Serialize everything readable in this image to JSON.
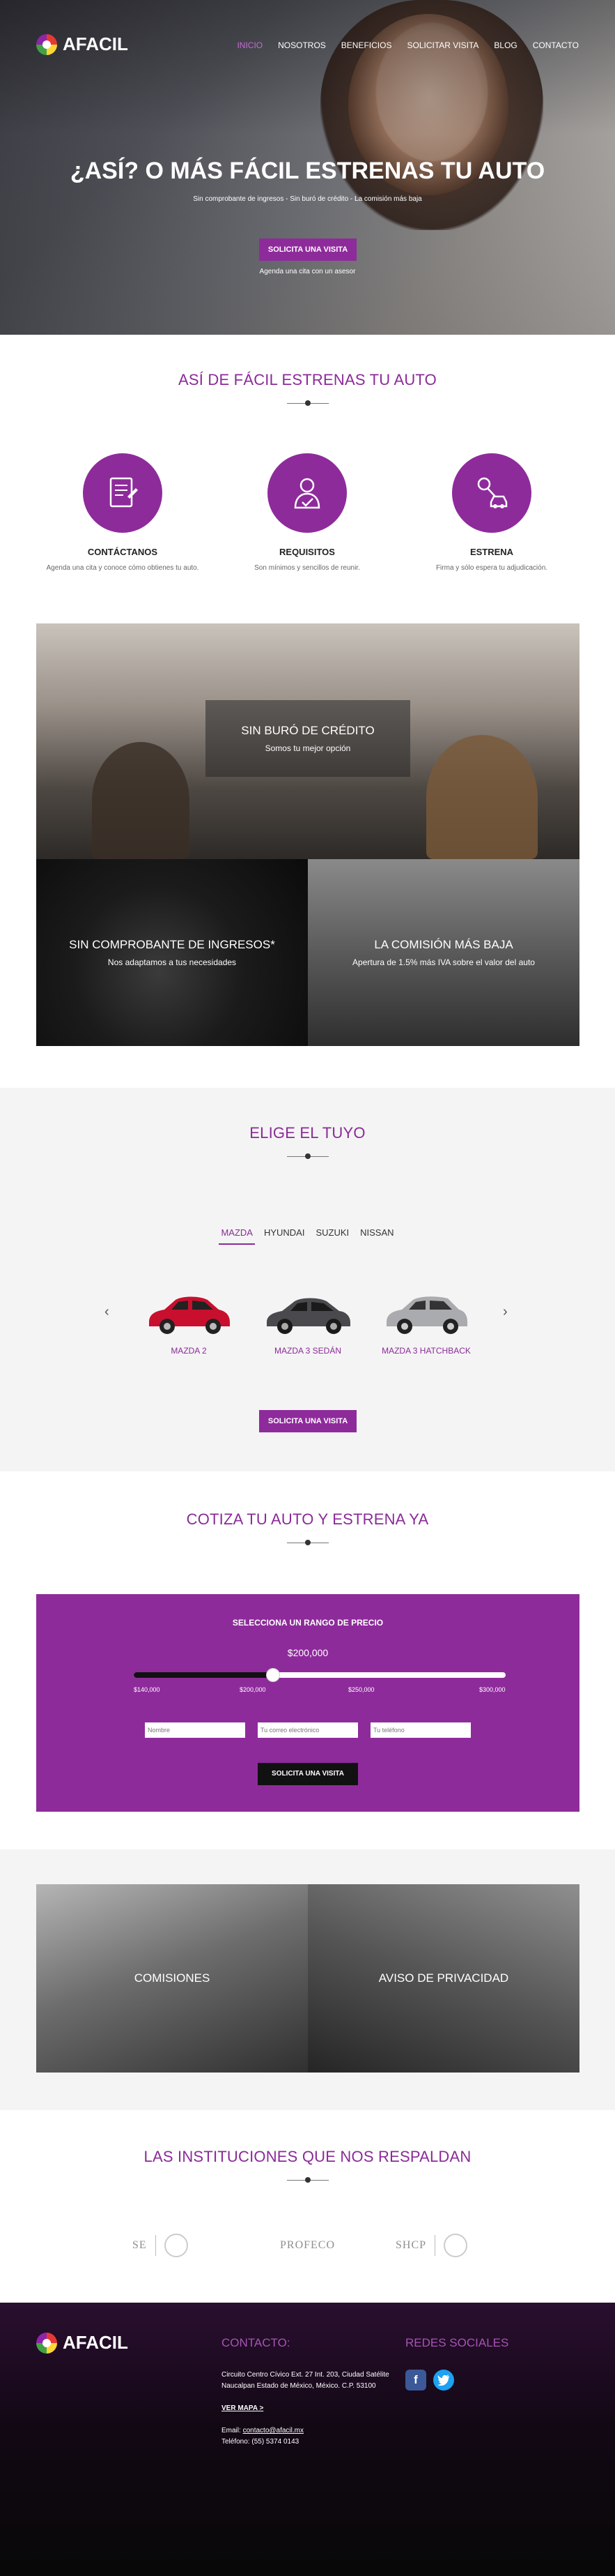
{
  "brand": {
    "name": "AFACIL"
  },
  "nav": [
    "INICIO",
    "NOSOTROS",
    "BENEFICIOS",
    "SOLICITAR VISITA",
    "BLOG",
    "CONTACTO"
  ],
  "hero": {
    "title": "¿ASÍ? O MÁS FÁCIL ESTRENAS TU AUTO",
    "subtitle": "Sin comprobante de ingresos - Sin buró de crédito - La comisión más baja",
    "button": "SOLICITA UNA VISITA",
    "note": "Agenda una cita con un asesor"
  },
  "steps_section": {
    "title": "ASÍ DE FÁCIL ESTRENAS TU AUTO",
    "steps": [
      {
        "title": "CONTÁCTANOS",
        "text": "Agenda una cita y conoce cómo obtienes tu auto.",
        "icon": "document-icon"
      },
      {
        "title": "REQUISITOS",
        "text": "Son mínimos y sencillos de reunir.",
        "icon": "user-check-icon"
      },
      {
        "title": "ESTRENA",
        "text": "Firma y sólo espera tu adjudicación.",
        "icon": "car-key-icon"
      }
    ]
  },
  "features": [
    {
      "title": "SIN BURÓ DE CRÉDITO",
      "text": "Somos tu mejor opción"
    },
    {
      "title": "SIN COMPROBANTE DE INGRESOS*",
      "text": "Nos adaptamos a tus necesidades"
    },
    {
      "title": "LA COMISIÓN MÁS BAJA",
      "text": "Apertura de 1.5% más IVA sobre el valor del auto"
    }
  ],
  "choose": {
    "title": "ELIGE EL TUYO",
    "tabs": [
      "MAZDA",
      "HYUNDAI",
      "SUZUKI",
      "NISSAN"
    ],
    "active_tab": "MAZDA",
    "cars": [
      {
        "name": "MAZDA 2",
        "color": "#c8102e"
      },
      {
        "name": "MAZDA 3 SEDÁN",
        "color": "#4a4a4e"
      },
      {
        "name": "MAZDA 3 HATCHBACK",
        "color": "#a9abae"
      }
    ],
    "button": "SOLICITA UNA VISITA",
    "prev": "‹",
    "next": "›"
  },
  "quote": {
    "title": "COTIZA TU AUTO Y ESTRENA YA",
    "panel_title": "SELECCIONA UN RANGO DE PRECIO",
    "price": "$200,000",
    "range": {
      "min": 140000,
      "max": 300000,
      "value": 200000
    },
    "ticks": [
      "$140,000",
      "$200,000",
      "$250,000",
      "$300,000"
    ],
    "fields": {
      "name": "Nombre",
      "email": "Tu correo electrónico",
      "phone": "Tu teléfono"
    },
    "button": "SOLICITA UNA VISITA"
  },
  "info_tiles": [
    "COMISIONES",
    "AVISO DE PRIVACIDAD"
  ],
  "institutions": {
    "title": "LAS INSTITUCIONES QUE NOS RESPALDAN",
    "logos": [
      "SE",
      "PROFECO",
      "SHCP"
    ]
  },
  "footer": {
    "contact_title": "CONTACTO:",
    "address1": "Circuito Centro Cívico Ext. 27 Int. 203, Ciudad Satélite",
    "address2": "Naucalpan Estado de México, México. C.P. 53100",
    "map_link": "VER MAPA >",
    "email_label": "Email:",
    "email": "contacto@afacil.mx",
    "phone": "Teléfono: (55) 5374 0143",
    "social_title": "REDES SOCIALES",
    "colors": {
      "facebook": "#3b5998",
      "twitter": "#1da1f2"
    }
  },
  "colors": {
    "accent": "#8e2b9b"
  }
}
